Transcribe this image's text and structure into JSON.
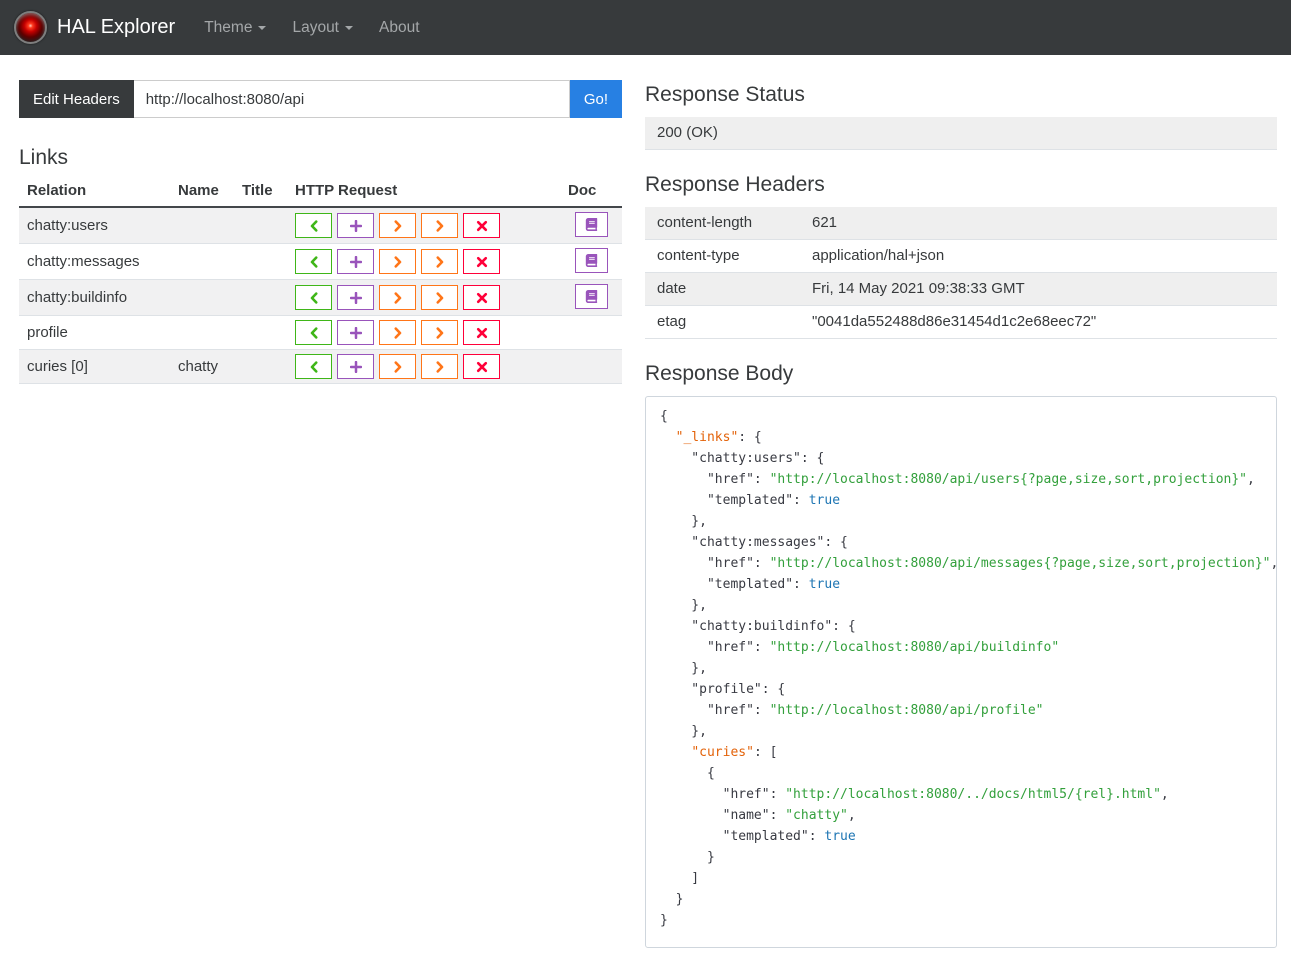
{
  "navbar": {
    "brand": "HAL Explorer",
    "items": [
      {
        "label": "Theme",
        "caret": true
      },
      {
        "label": "Layout",
        "caret": true
      },
      {
        "label": "About",
        "caret": false
      }
    ]
  },
  "request_bar": {
    "edit_headers_label": "Edit Headers",
    "url_value": "http://localhost:8080/api",
    "go_label": "Go!"
  },
  "links": {
    "title": "Links",
    "columns": [
      "Relation",
      "Name",
      "Title",
      "HTTP Request",
      "Doc"
    ],
    "http_buttons": [
      {
        "name": "get-button",
        "icon": "chevron-left-icon",
        "color": "#3fb618"
      },
      {
        "name": "post-button",
        "icon": "plus-icon",
        "color": "#9954bb"
      },
      {
        "name": "put-button",
        "icon": "chevron-right-icon",
        "color": "#ff7518"
      },
      {
        "name": "patch-button",
        "icon": "chevron-right-icon",
        "color": "#ff7518"
      },
      {
        "name": "delete-button",
        "icon": "x-icon",
        "color": "#ff0039"
      }
    ],
    "doc_button": {
      "name": "doc-button",
      "icon": "book-icon",
      "color": "#9954bb"
    },
    "rows": [
      {
        "relation": "chatty:users",
        "name": "",
        "title": "",
        "doc": true
      },
      {
        "relation": "chatty:messages",
        "name": "",
        "title": "",
        "doc": true
      },
      {
        "relation": "chatty:buildinfo",
        "name": "",
        "title": "",
        "doc": true
      },
      {
        "relation": "profile",
        "name": "",
        "title": "",
        "doc": false
      },
      {
        "relation": "curies [0]",
        "name": "chatty",
        "title": "",
        "doc": false
      }
    ]
  },
  "response": {
    "status_title": "Response Status",
    "status_value": "200 (OK)",
    "headers_title": "Response Headers",
    "headers": [
      {
        "name": "content-length",
        "value": "621"
      },
      {
        "name": "content-type",
        "value": "application/hal+json"
      },
      {
        "name": "date",
        "value": "Fri, 14 May 2021 09:38:33 GMT"
      },
      {
        "name": "etag",
        "value": "\"0041da552488d86e31454d1c2e68eec72\""
      }
    ],
    "body_title": "Response Body",
    "body_lines": [
      [
        [
          "pl",
          "{"
        ]
      ],
      [
        [
          "pl",
          "  "
        ],
        [
          "sk",
          "\"_links\""
        ],
        [
          "pl",
          ": {"
        ]
      ],
      [
        [
          "pl",
          "    \"chatty:users\": {"
        ]
      ],
      [
        [
          "pl",
          "      \"href\": "
        ],
        [
          "st",
          "\"http://localhost:8080/api/users{?page,size,sort,projection}\""
        ],
        [
          "pl",
          ","
        ]
      ],
      [
        [
          "pl",
          "      \"templated\": "
        ],
        [
          "li",
          "true"
        ]
      ],
      [
        [
          "pl",
          "    },"
        ]
      ],
      [
        [
          "pl",
          "    \"chatty:messages\": {"
        ]
      ],
      [
        [
          "pl",
          "      \"href\": "
        ],
        [
          "st",
          "\"http://localhost:8080/api/messages{?page,size,sort,projection}\""
        ],
        [
          "pl",
          ","
        ]
      ],
      [
        [
          "pl",
          "      \"templated\": "
        ],
        [
          "li",
          "true"
        ]
      ],
      [
        [
          "pl",
          "    },"
        ]
      ],
      [
        [
          "pl",
          "    \"chatty:buildinfo\": {"
        ]
      ],
      [
        [
          "pl",
          "      \"href\": "
        ],
        [
          "st",
          "\"http://localhost:8080/api/buildinfo\""
        ]
      ],
      [
        [
          "pl",
          "    },"
        ]
      ],
      [
        [
          "pl",
          "    \"profile\": {"
        ]
      ],
      [
        [
          "pl",
          "      \"href\": "
        ],
        [
          "st",
          "\"http://localhost:8080/api/profile\""
        ]
      ],
      [
        [
          "pl",
          "    },"
        ]
      ],
      [
        [
          "pl",
          "    "
        ],
        [
          "sk",
          "\"curies\""
        ],
        [
          "pl",
          ": ["
        ]
      ],
      [
        [
          "pl",
          "      {"
        ]
      ],
      [
        [
          "pl",
          "        \"href\": "
        ],
        [
          "st",
          "\"http://localhost:8080/../docs/html5/{rel}.html\""
        ],
        [
          "pl",
          ","
        ]
      ],
      [
        [
          "pl",
          "        \"name\": "
        ],
        [
          "st",
          "\"chatty\""
        ],
        [
          "pl",
          ","
        ]
      ],
      [
        [
          "pl",
          "        \"templated\": "
        ],
        [
          "li",
          "true"
        ]
      ],
      [
        [
          "pl",
          "      }"
        ]
      ],
      [
        [
          "pl",
          "    ]"
        ]
      ],
      [
        [
          "pl",
          "  }"
        ]
      ],
      [
        [
          "pl",
          "}"
        ]
      ]
    ]
  },
  "colors": {
    "navbar_bg": "#373a3c",
    "primary": "#2780e3",
    "success": "#3fb618",
    "purple": "#9954bb",
    "orange": "#ff7518",
    "danger": "#ff0039",
    "code_special_key": "#e36209",
    "code_string": "#33a03c",
    "code_literal": "#1d75b3"
  }
}
